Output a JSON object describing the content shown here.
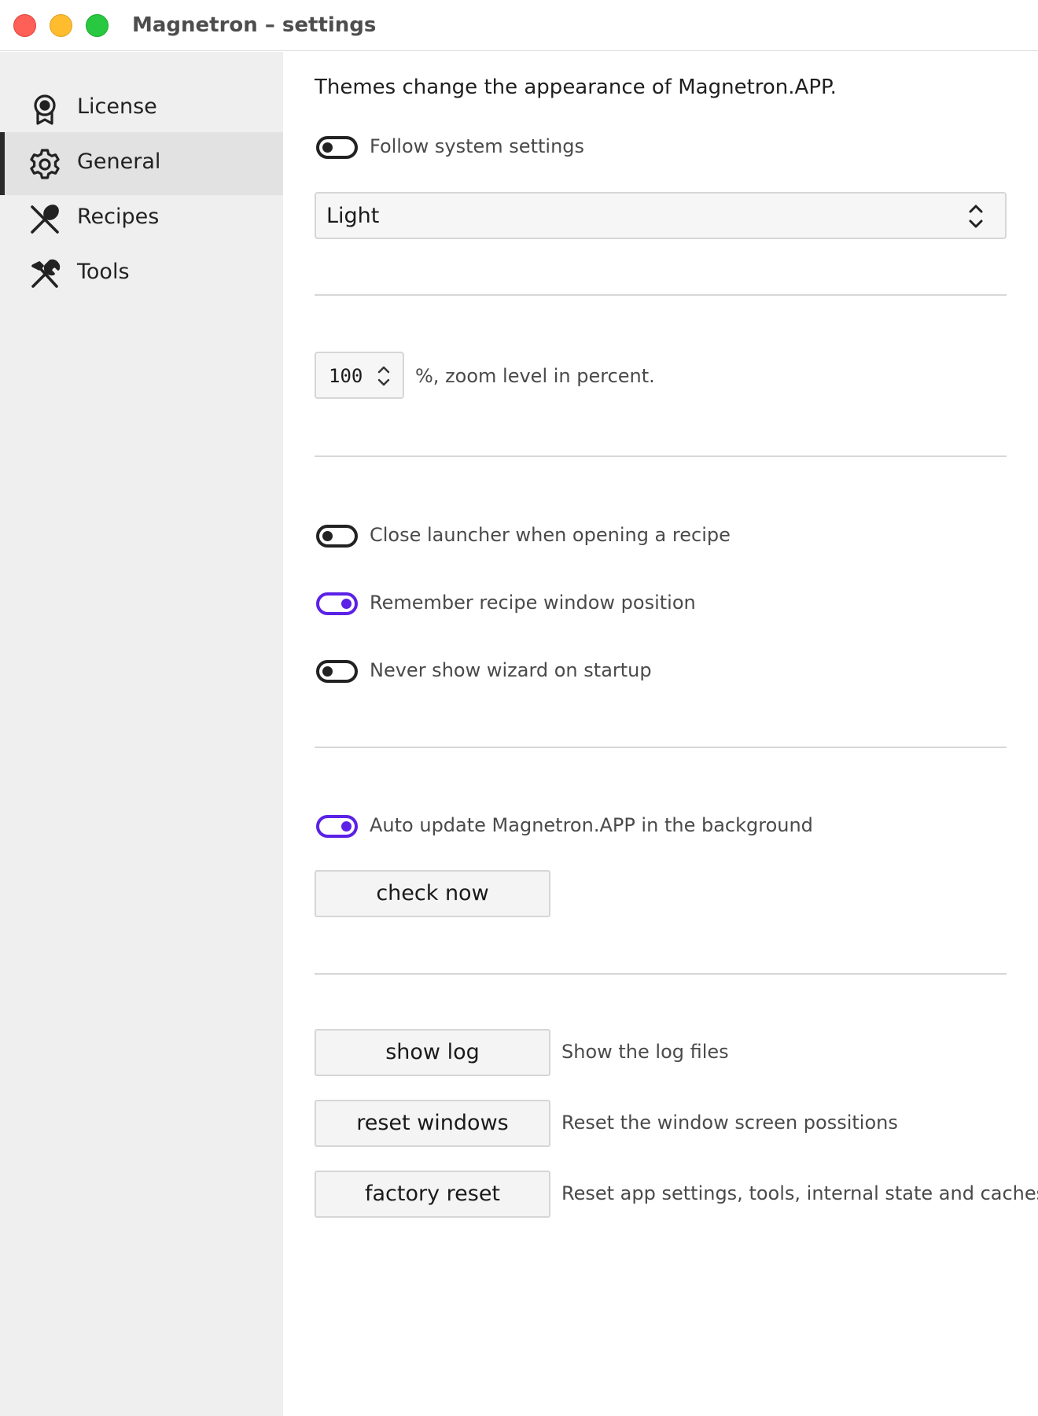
{
  "window": {
    "title": "Magnetron – settings"
  },
  "sidebar": {
    "items": [
      {
        "label": "License",
        "icon": "award-icon",
        "active": false
      },
      {
        "label": "General",
        "icon": "gear-icon",
        "active": true
      },
      {
        "label": "Recipes",
        "icon": "utensils-icon",
        "active": false
      },
      {
        "label": "Tools",
        "icon": "tools-icon",
        "active": false
      }
    ]
  },
  "main": {
    "theme": {
      "description": "Themes change the appearance of Magnetron.APP.",
      "follow_system_label": "Follow system settings",
      "follow_system_on": false,
      "selected": "Light"
    },
    "zoom": {
      "value": "100",
      "label": "%, zoom level in percent."
    },
    "behavior": {
      "close_launcher_label": "Close launcher when opening a recipe",
      "close_launcher_on": false,
      "remember_position_label": "Remember recipe window position",
      "remember_position_on": true,
      "never_wizard_label": "Never show wizard on startup",
      "never_wizard_on": false
    },
    "update": {
      "auto_update_label": "Auto update Magnetron.APP in the background",
      "auto_update_on": true,
      "check_now_label": "check now"
    },
    "maintenance": {
      "show_log_label": "show log",
      "show_log_desc": "Show the log files",
      "reset_windows_label": "reset windows",
      "reset_windows_desc": "Reset the window screen possitions",
      "factory_reset_label": "factory reset",
      "factory_reset_desc": "Reset app settings, tools, internal state and caches"
    }
  },
  "colors": {
    "accent": "#5b21e6",
    "sidebar_bg": "#efefef",
    "sidebar_active_bg": "#e2e2e2",
    "close": "#fe5f57",
    "minimize": "#febc2e",
    "maximize": "#28c840"
  }
}
